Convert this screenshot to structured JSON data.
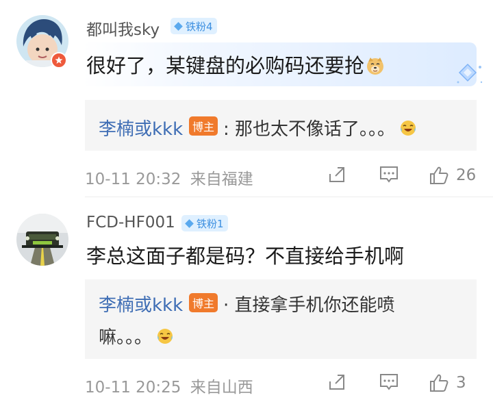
{
  "comments": [
    {
      "username": "都叫我sky",
      "fan_badge": "铁粉4",
      "text": "很好了，某键盘的必购码还要抢",
      "reply": {
        "name": "李楠或kkk",
        "host_badge": "博主",
        "text": ": 那也太不像话了。。。"
      },
      "time": "10-11 20:32",
      "location": "来自福建",
      "likes": "26"
    },
    {
      "username": "FCD-HF001",
      "fan_badge": "铁粉1",
      "text": "李总这面子都是码？不直接给手机啊",
      "reply": {
        "name": "李楠或kkk",
        "host_badge": "博主",
        "text": "· 直接拿手机你还能喷",
        "text_line2": "嘛。。。"
      },
      "time": "10-11 20:25",
      "location": "来自山西",
      "likes": "3"
    }
  ],
  "icons": {
    "share": "share-icon",
    "comment": "comment-icon",
    "like": "thumbs-up-icon",
    "emoji_doge": "doge-emoji-icon",
    "emoji_laugh": "laugh-cry-emoji-icon"
  },
  "colors": {
    "reply_name": "#3e6db4",
    "host_badge": "#f07a2c",
    "fan_badge_bg": "#dff0ff",
    "meta": "#999999"
  }
}
